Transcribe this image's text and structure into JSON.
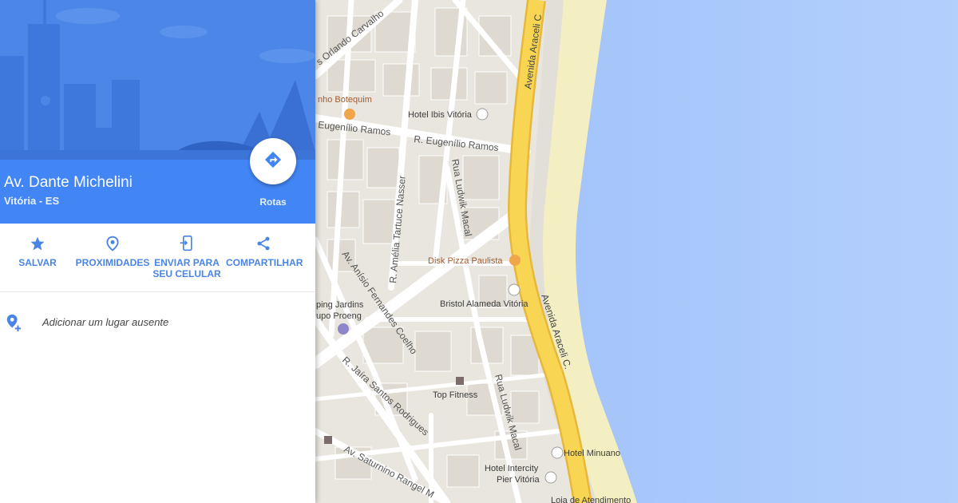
{
  "place": {
    "title": "Av. Dante Michelini",
    "subtitle": "Vitória - ES"
  },
  "route": {
    "label": "Rotas",
    "icon": "directions-icon"
  },
  "actions": [
    {
      "label": "SALVAR",
      "icon": "star-icon"
    },
    {
      "label": "PROXIMIDADES",
      "icon": "nearby-pin-icon"
    },
    {
      "label": "ENVIAR PARA\nSEU CELULAR",
      "icon": "send-to-phone-icon"
    },
    {
      "label": "COMPARTILHAR",
      "icon": "share-icon"
    }
  ],
  "missing_place": {
    "label": "Adicionar um lugar ausente",
    "icon": "add-place-icon"
  },
  "map": {
    "streets": [
      "s Orlando Carvalho",
      "R. Eugenílio Ramos",
      "Eugenílio Ramos",
      "R. Amélia Tartuce Nasser",
      "Rua Ludwik Macal",
      "Av. Anísio Fernandes Coelho",
      "R. Jaíra Santos Rodrigues",
      "Rua Ludwik Macal",
      "Av. Saturnino Rangel M",
      "Avenida Araceli C",
      "Avenida Araceli C."
    ],
    "pois": [
      "nho Botequim",
      "Hotel Ibis Vitória",
      "Disk Pizza Paulista",
      "Bristol Alameda Vitória",
      "ping Jardins",
      "upo Proeng",
      "Top Fitness",
      "Hotel Minuano",
      "Hotel Intercity",
      "Pier Vitória",
      "Loja de Atendimento"
    ]
  },
  "colors": {
    "header_blue": "#4285f4",
    "accent_blue": "#4a85e6",
    "water": "#a7c7fb",
    "highway": "#f7d453",
    "beach": "#f3eebd",
    "land": "#e9e5dc"
  }
}
